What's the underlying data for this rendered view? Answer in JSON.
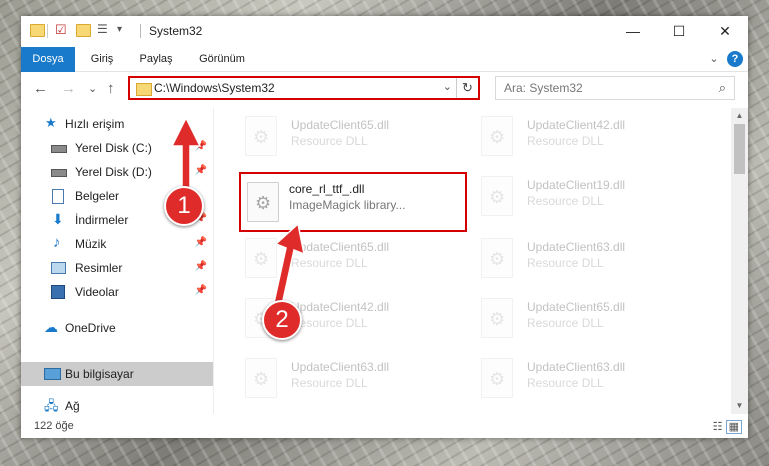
{
  "window": {
    "title": "System32",
    "controls": {
      "minimize": "—",
      "maximize": "☐",
      "close": "✕"
    }
  },
  "ribbon": {
    "tabs": [
      "Dosya",
      "Giriş",
      "Paylaş",
      "Görünüm"
    ],
    "expand_icon": "⌄",
    "help_icon": "?"
  },
  "nav": {
    "back": "←",
    "forward": "→",
    "recent": "⌄",
    "up": "↑"
  },
  "address": {
    "path": "C:\\Windows\\System32",
    "dropdown": "⌄",
    "refresh": "↻"
  },
  "search": {
    "placeholder": "Ara: System32",
    "icon": "⌕"
  },
  "sidebar": {
    "items": [
      {
        "label": "Hızlı erişim",
        "icon": "star-icon"
      },
      {
        "label": "Yerel Disk (C:)",
        "icon": "drive-icon",
        "pinned": true
      },
      {
        "label": "Yerel Disk (D:)",
        "icon": "drive-icon",
        "pinned": true
      },
      {
        "label": "Belgeler",
        "icon": "documents-icon"
      },
      {
        "label": "İndirmeler",
        "icon": "download-icon",
        "pinned": true
      },
      {
        "label": "Müzik",
        "icon": "music-icon",
        "pinned": true
      },
      {
        "label": "Resimler",
        "icon": "pictures-icon",
        "pinned": true
      },
      {
        "label": "Videolar",
        "icon": "videos-icon",
        "pinned": true
      },
      {
        "label": "OneDrive",
        "icon": "cloud-icon"
      },
      {
        "label": "Bu bilgisayar",
        "icon": "computer-icon",
        "selected": true
      },
      {
        "label": "Ağ",
        "icon": "network-icon"
      }
    ]
  },
  "files": [
    {
      "name": "UpdateClient65.dll",
      "type": "Resource DLL"
    },
    {
      "name": "UpdateClient42.dll",
      "type": "Resource DLL"
    },
    {
      "name": "core_rl_ttf_.dll",
      "type": "ImageMagick library...",
      "highlighted": true
    },
    {
      "name": "UpdateClient19.dll",
      "type": "Resource DLL"
    },
    {
      "name": "UpdateClient65.dll",
      "type": "Resource DLL"
    },
    {
      "name": "UpdateClient63.dll",
      "type": "Resource DLL"
    },
    {
      "name": "UpdateClient42.dll",
      "type": "Resource DLL"
    },
    {
      "name": "UpdateClient65.dll",
      "type": "Resource DLL"
    },
    {
      "name": "UpdateClient63.dll",
      "type": "Resource DLL"
    },
    {
      "name": "UpdateClient63.dll",
      "type": "Resource DLL"
    }
  ],
  "status": {
    "count": "122 öğe"
  },
  "markers": [
    "1",
    "2"
  ],
  "colors": {
    "accent": "#1979ca",
    "highlight": "#d40000",
    "marker": "#e02b2b"
  }
}
